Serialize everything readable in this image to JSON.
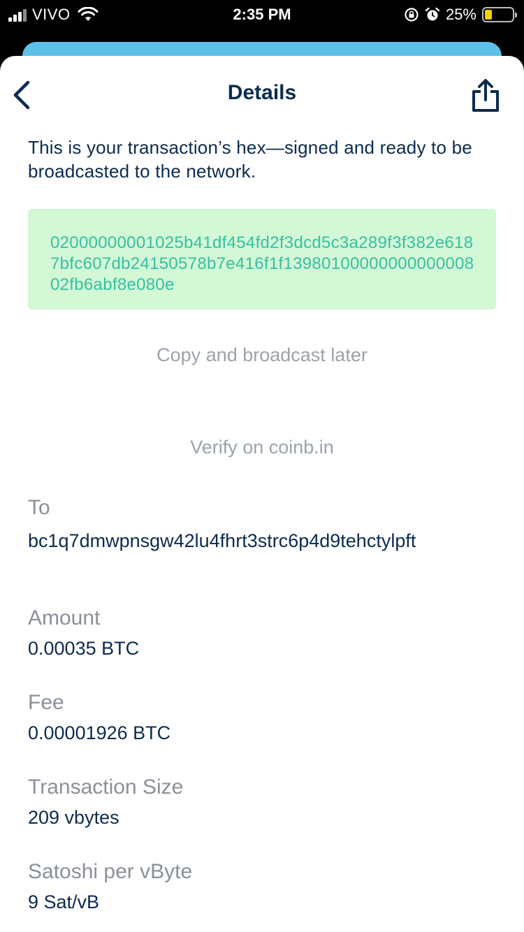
{
  "status_bar": {
    "carrier": "VIVO",
    "time": "2:35 PM",
    "battery": "25%",
    "battery_level": 0.25
  },
  "header": {
    "title": "Details"
  },
  "intro_text": "This is your transaction’s hex—signed and ready to be broadcasted to the network.",
  "hex": "02000000001025b41df454fd2f3dcd5c3a289f3f382e6187bfc607db24150578b7e416f1f1398010000000000000802fb6abf8e080e",
  "actions": {
    "copy_label": "Copy and broadcast later",
    "verify_label": "Verify on coinb.in"
  },
  "details": {
    "to_label": "To",
    "to_value": "bc1q7dmwpnsgw42lu4fhrt3strc6p4d9tehctylpft",
    "amount_label": "Amount",
    "amount_value": "0.00035 BTC",
    "fee_label": "Fee",
    "fee_value": "0.00001926 BTC",
    "size_label": "Transaction Size",
    "size_value": "209 vbytes",
    "sat_label": "Satoshi per vByte",
    "sat_value": "9 Sat/vB"
  },
  "colors": {
    "primary_text": "#0c2b50",
    "hex_background": "#d2f8d6",
    "hex_text": "#37c0a1",
    "secondary_text": "#9aa3ad",
    "sheet_behind": "#5dc0e8"
  },
  "icons": {
    "back": "chevron-left-icon",
    "share": "share-icon",
    "wifi": "wifi-icon",
    "lock_rotation": "rotation-lock-icon",
    "alarm": "alarm-icon",
    "battery": "battery-icon",
    "signal": "signal-icon"
  }
}
